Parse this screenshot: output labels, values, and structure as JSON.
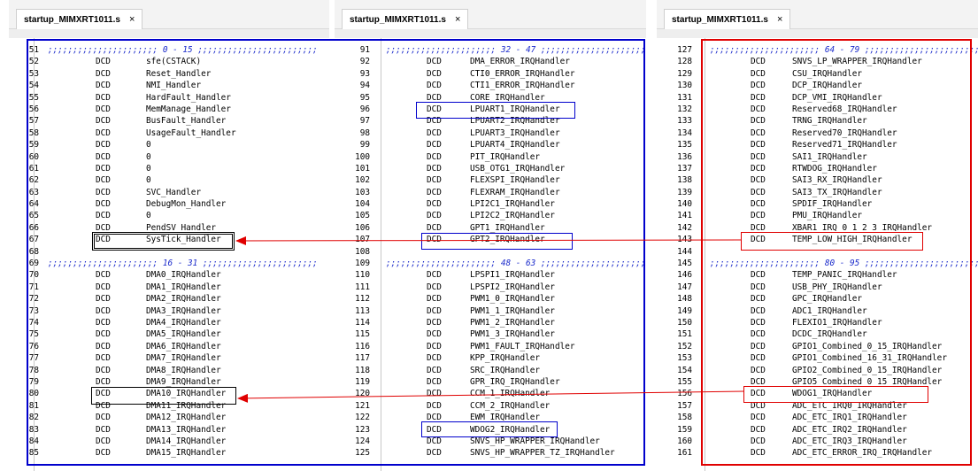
{
  "colors": {
    "blue_frame": "#0000cc",
    "red_frame": "#e00000",
    "comment": "#1a2acb",
    "arrow": "#e00000"
  },
  "panels": [
    {
      "tab_label": "startup_MIMXRT1011.s",
      "close_icon": "×",
      "lines": [
        {
          "n": "51",
          "c": ";;;;;;;;;;;;;;;;;;;;;; 0 - 15 ;;;;;;;;;;;;;;;;;;;;;;;;"
        },
        {
          "n": "52",
          "k": "DCD",
          "h": "sfe(CSTACK)"
        },
        {
          "n": "53",
          "k": "DCD",
          "h": "Reset_Handler"
        },
        {
          "n": "54",
          "k": "DCD",
          "h": "NMI_Handler"
        },
        {
          "n": "55",
          "k": "DCD",
          "h": "HardFault_Handler"
        },
        {
          "n": "56",
          "k": "DCD",
          "h": "MemManage_Handler"
        },
        {
          "n": "57",
          "k": "DCD",
          "h": "BusFault_Handler"
        },
        {
          "n": "58",
          "k": "DCD",
          "h": "UsageFault_Handler"
        },
        {
          "n": "59",
          "k": "DCD",
          "h": "0"
        },
        {
          "n": "60",
          "k": "DCD",
          "h": "0"
        },
        {
          "n": "61",
          "k": "DCD",
          "h": "0"
        },
        {
          "n": "62",
          "k": "DCD",
          "h": "0"
        },
        {
          "n": "63",
          "k": "DCD",
          "h": "SVC_Handler"
        },
        {
          "n": "64",
          "k": "DCD",
          "h": "DebugMon_Handler"
        },
        {
          "n": "65",
          "k": "DCD",
          "h": "0"
        },
        {
          "n": "66",
          "k": "DCD",
          "h": "PendSV_Handler"
        },
        {
          "n": "67",
          "k": "DCD",
          "h": "SysTick_Handler"
        },
        {
          "n": "68"
        },
        {
          "n": "69",
          "c": ";;;;;;;;;;;;;;;;;;;;;; 16 - 31 ;;;;;;;;;;;;;;;;;;;;;;;"
        },
        {
          "n": "70",
          "k": "DCD",
          "h": "DMA0_IRQHandler"
        },
        {
          "n": "71",
          "k": "DCD",
          "h": "DMA1_IRQHandler"
        },
        {
          "n": "72",
          "k": "DCD",
          "h": "DMA2_IRQHandler"
        },
        {
          "n": "73",
          "k": "DCD",
          "h": "DMA3_IRQHandler"
        },
        {
          "n": "74",
          "k": "DCD",
          "h": "DMA4_IRQHandler"
        },
        {
          "n": "75",
          "k": "DCD",
          "h": "DMA5_IRQHandler"
        },
        {
          "n": "76",
          "k": "DCD",
          "h": "DMA6_IRQHandler"
        },
        {
          "n": "77",
          "k": "DCD",
          "h": "DMA7_IRQHandler"
        },
        {
          "n": "78",
          "k": "DCD",
          "h": "DMA8_IRQHandler"
        },
        {
          "n": "79",
          "k": "DCD",
          "h": "DMA9_IRQHandler"
        },
        {
          "n": "80",
          "k": "DCD",
          "h": "DMA10_IRQHandler"
        },
        {
          "n": "81",
          "k": "DCD",
          "h": "DMA11_IRQHandler"
        },
        {
          "n": "82",
          "k": "DCD",
          "h": "DMA12_IRQHandler"
        },
        {
          "n": "83",
          "k": "DCD",
          "h": "DMA13_IRQHandler"
        },
        {
          "n": "84",
          "k": "DCD",
          "h": "DMA14_IRQHandler"
        },
        {
          "n": "85",
          "k": "DCD",
          "h": "DMA15_IRQHandler"
        }
      ]
    },
    {
      "tab_label": "startup_MIMXRT1011.s",
      "close_icon": "×",
      "lines": [
        {
          "n": "91",
          "c": ";;;;;;;;;;;;;;;;;;;;;; 32 - 47 ;;;;;;;;;;;;;;;;;;;;;;;;"
        },
        {
          "n": "92",
          "k": "DCD",
          "h": "DMA_ERROR_IRQHandler"
        },
        {
          "n": "93",
          "k": "DCD",
          "h": "CTI0_ERROR_IRQHandler"
        },
        {
          "n": "94",
          "k": "DCD",
          "h": "CTI1_ERROR_IRQHandler"
        },
        {
          "n": "95",
          "k": "DCD",
          "h": "CORE_IRQHandler"
        },
        {
          "n": "96",
          "k": "DCD",
          "h": "LPUART1_IRQHandler"
        },
        {
          "n": "97",
          "k": "DCD",
          "h": "LPUART2_IRQHandler"
        },
        {
          "n": "98",
          "k": "DCD",
          "h": "LPUART3_IRQHandler"
        },
        {
          "n": "99",
          "k": "DCD",
          "h": "LPUART4_IRQHandler"
        },
        {
          "n": "100",
          "k": "DCD",
          "h": "PIT_IRQHandler"
        },
        {
          "n": "101",
          "k": "DCD",
          "h": "USB_OTG1_IRQHandler"
        },
        {
          "n": "102",
          "k": "DCD",
          "h": "FLEXSPI_IRQHandler"
        },
        {
          "n": "103",
          "k": "DCD",
          "h": "FLEXRAM_IRQHandler"
        },
        {
          "n": "104",
          "k": "DCD",
          "h": "LPI2C1_IRQHandler"
        },
        {
          "n": "105",
          "k": "DCD",
          "h": "LPI2C2_IRQHandler"
        },
        {
          "n": "106",
          "k": "DCD",
          "h": "GPT1_IRQHandler"
        },
        {
          "n": "107",
          "k": "DCD",
          "h": "GPT2_IRQHandler"
        },
        {
          "n": "108"
        },
        {
          "n": "109",
          "c": ";;;;;;;;;;;;;;;;;;;;;; 48 - 63 ;;;;;;;;;;;;;;;;;;;;;;;;"
        },
        {
          "n": "110",
          "k": "DCD",
          "h": "LPSPI1_IRQHandler"
        },
        {
          "n": "111",
          "k": "DCD",
          "h": "LPSPI2_IRQHandler"
        },
        {
          "n": "112",
          "k": "DCD",
          "h": "PWM1_0_IRQHandler"
        },
        {
          "n": "113",
          "k": "DCD",
          "h": "PWM1_1_IRQHandler"
        },
        {
          "n": "114",
          "k": "DCD",
          "h": "PWM1_2_IRQHandler"
        },
        {
          "n": "115",
          "k": "DCD",
          "h": "PWM1_3_IRQHandler"
        },
        {
          "n": "116",
          "k": "DCD",
          "h": "PWM1_FAULT_IRQHandler"
        },
        {
          "n": "117",
          "k": "DCD",
          "h": "KPP_IRQHandler"
        },
        {
          "n": "118",
          "k": "DCD",
          "h": "SRC_IRQHandler"
        },
        {
          "n": "119",
          "k": "DCD",
          "h": "GPR_IRQ_IRQHandler"
        },
        {
          "n": "120",
          "k": "DCD",
          "h": "CCM_1_IRQHandler"
        },
        {
          "n": "121",
          "k": "DCD",
          "h": "CCM_2_IRQHandler"
        },
        {
          "n": "122",
          "k": "DCD",
          "h": "EWM_IRQHandler"
        },
        {
          "n": "123",
          "k": "DCD",
          "h": "WDOG2_IRQHandler"
        },
        {
          "n": "124",
          "k": "DCD",
          "h": "SNVS_HP_WRAPPER_IRQHandler"
        },
        {
          "n": "125",
          "k": "DCD",
          "h": "SNVS_HP_WRAPPER_TZ_IRQHandler"
        }
      ]
    },
    {
      "tab_label": "startup_MIMXRT1011.s",
      "close_icon": "×",
      "lines": [
        {
          "n": "127",
          "c": ";;;;;;;;;;;;;;;;;;;;;; 64 - 79 ;;;;;;;;;;;;;;;;;;;;;;;;"
        },
        {
          "n": "128",
          "k": "DCD",
          "h": "SNVS_LP_WRAPPER_IRQHandler"
        },
        {
          "n": "129",
          "k": "DCD",
          "h": "CSU_IRQHandler"
        },
        {
          "n": "130",
          "k": "DCD",
          "h": "DCP_IRQHandler"
        },
        {
          "n": "131",
          "k": "DCD",
          "h": "DCP_VMI_IRQHandler"
        },
        {
          "n": "132",
          "k": "DCD",
          "h": "Reserved68_IRQHandler"
        },
        {
          "n": "133",
          "k": "DCD",
          "h": "TRNG_IRQHandler"
        },
        {
          "n": "134",
          "k": "DCD",
          "h": "Reserved70_IRQHandler"
        },
        {
          "n": "135",
          "k": "DCD",
          "h": "Reserved71_IRQHandler"
        },
        {
          "n": "136",
          "k": "DCD",
          "h": "SAI1_IRQHandler"
        },
        {
          "n": "137",
          "k": "DCD",
          "h": "RTWDOG_IRQHandler"
        },
        {
          "n": "138",
          "k": "DCD",
          "h": "SAI3_RX_IRQHandler"
        },
        {
          "n": "139",
          "k": "DCD",
          "h": "SAI3_TX_IRQHandler"
        },
        {
          "n": "140",
          "k": "DCD",
          "h": "SPDIF_IRQHandler"
        },
        {
          "n": "141",
          "k": "DCD",
          "h": "PMU_IRQHandler"
        },
        {
          "n": "142",
          "k": "DCD",
          "h": "XBAR1_IRQ_0_1_2_3_IRQHandler"
        },
        {
          "n": "143",
          "k": "DCD",
          "h": "TEMP_LOW_HIGH_IRQHandler"
        },
        {
          "n": "144"
        },
        {
          "n": "145",
          "c": ";;;;;;;;;;;;;;;;;;;;;; 80 - 95 ;;;;;;;;;;;;;;;;;;;;;;;;"
        },
        {
          "n": "146",
          "k": "DCD",
          "h": "TEMP_PANIC_IRQHandler"
        },
        {
          "n": "147",
          "k": "DCD",
          "h": "USB_PHY_IRQHandler"
        },
        {
          "n": "148",
          "k": "DCD",
          "h": "GPC_IRQHandler"
        },
        {
          "n": "149",
          "k": "DCD",
          "h": "ADC1_IRQHandler"
        },
        {
          "n": "150",
          "k": "DCD",
          "h": "FLEXIO1_IRQHandler"
        },
        {
          "n": "151",
          "k": "DCD",
          "h": "DCDC_IRQHandler"
        },
        {
          "n": "152",
          "k": "DCD",
          "h": "GPIO1_Combined_0_15_IRQHandler"
        },
        {
          "n": "153",
          "k": "DCD",
          "h": "GPIO1_Combined_16_31_IRQHandler"
        },
        {
          "n": "154",
          "k": "DCD",
          "h": "GPIO2_Combined_0_15_IRQHandler"
        },
        {
          "n": "155",
          "k": "DCD",
          "h": "GPIO5_Combined_0_15_IRQHandler"
        },
        {
          "n": "156",
          "k": "DCD",
          "h": "WDOG1_IRQHandler"
        },
        {
          "n": "157",
          "k": "DCD",
          "h": "ADC_ETC_IRQ0_IRQHandler"
        },
        {
          "n": "158",
          "k": "DCD",
          "h": "ADC_ETC_IRQ1_IRQHandler"
        },
        {
          "n": "159",
          "k": "DCD",
          "h": "ADC_ETC_IRQ2_IRQHandler"
        },
        {
          "n": "160",
          "k": "DCD",
          "h": "ADC_ETC_IRQ3_IRQHandler"
        },
        {
          "n": "161",
          "k": "DCD",
          "h": "ADC_ETC_ERROR_IRQ_IRQHandler"
        }
      ]
    }
  ]
}
